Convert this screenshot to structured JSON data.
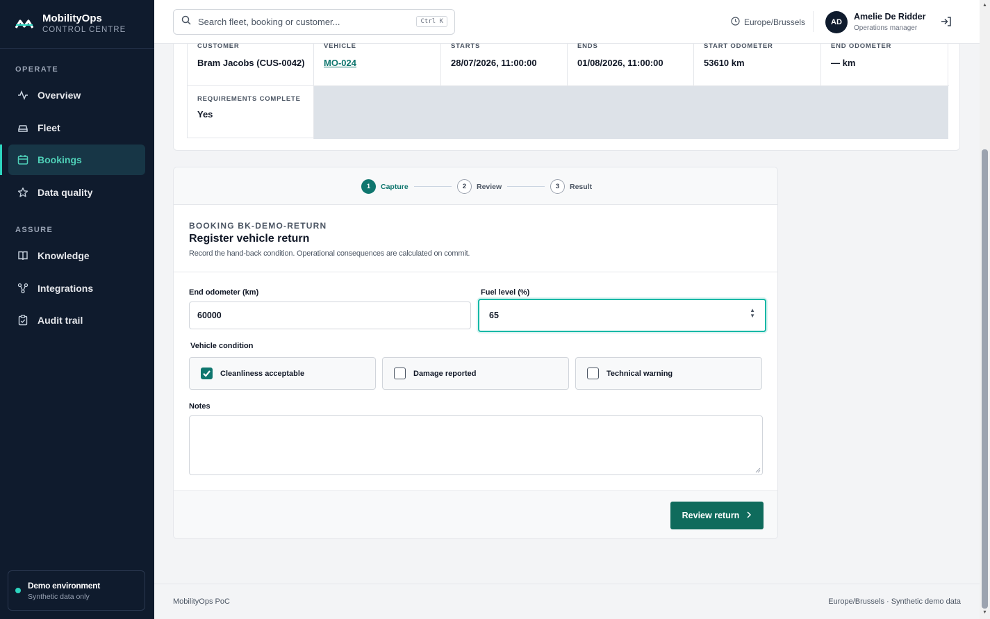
{
  "brand": {
    "name": "MobilityOps",
    "subtitle": "CONTROL CENTRE"
  },
  "sidebar": {
    "sections": [
      {
        "label": "OPERATE"
      },
      {
        "label": "ASSURE"
      }
    ],
    "items": [
      {
        "label": "Overview",
        "icon": "activity-icon"
      },
      {
        "label": "Fleet",
        "icon": "car-icon"
      },
      {
        "label": "Bookings",
        "icon": "calendar-icon",
        "active": true
      },
      {
        "label": "Data quality",
        "icon": "star-icon"
      },
      {
        "label": "Knowledge",
        "icon": "book-icon"
      },
      {
        "label": "Integrations",
        "icon": "network-icon"
      },
      {
        "label": "Audit trail",
        "icon": "clipboard-check-icon"
      }
    ],
    "demo": {
      "title": "Demo environment",
      "subtitle": "Synthetic data only"
    }
  },
  "topbar": {
    "search_placeholder": "Search fleet, booking or customer...",
    "shortcut": "Ctrl K",
    "timezone": "Europe/Brussels",
    "user": {
      "initials": "AD",
      "name": "Amelie De Ridder",
      "role": "Operations manager"
    }
  },
  "details": {
    "cells": [
      {
        "label": "CUSTOMER",
        "value": "Bram Jacobs (CUS-0042)"
      },
      {
        "label": "VEHICLE",
        "value": "MO-024"
      },
      {
        "label": "STARTS",
        "value": "28/07/2026, 11:00:00"
      },
      {
        "label": "ENDS",
        "value": "01/08/2026, 11:00:00"
      },
      {
        "label": "START ODOMETER",
        "value": "53610 km"
      },
      {
        "label": "END ODOMETER",
        "value": "— km"
      }
    ],
    "requirements": {
      "label": "REQUIREMENTS COMPLETE",
      "value": "Yes"
    }
  },
  "stepper": {
    "steps": [
      {
        "num": "1",
        "label": "Capture",
        "active": true
      },
      {
        "num": "2",
        "label": "Review"
      },
      {
        "num": "3",
        "label": "Result"
      }
    ]
  },
  "form": {
    "eyebrow": "BOOKING BK-DEMO-RETURN",
    "title": "Register vehicle return",
    "description": "Record the hand-back condition. Operational consequences are calculated on commit.",
    "end_odometer_label": "End odometer (km)",
    "end_odometer_value": "60000",
    "fuel_label": "Fuel level (%)",
    "fuel_value": "65",
    "condition_label": "Vehicle condition",
    "conditions": [
      {
        "label": "Cleanliness acceptable",
        "checked": true
      },
      {
        "label": "Damage reported",
        "checked": false
      },
      {
        "label": "Technical warning",
        "checked": false
      }
    ],
    "notes_label": "Notes",
    "notes_value": "",
    "submit_label": "Review return"
  },
  "footer": {
    "left": "MobilityOps PoC",
    "right": "Europe/Brussels · Synthetic demo data"
  },
  "colors": {
    "accent": "#0f766e",
    "sidebar": "#0f1b2d",
    "focus": "#14b8a6"
  }
}
